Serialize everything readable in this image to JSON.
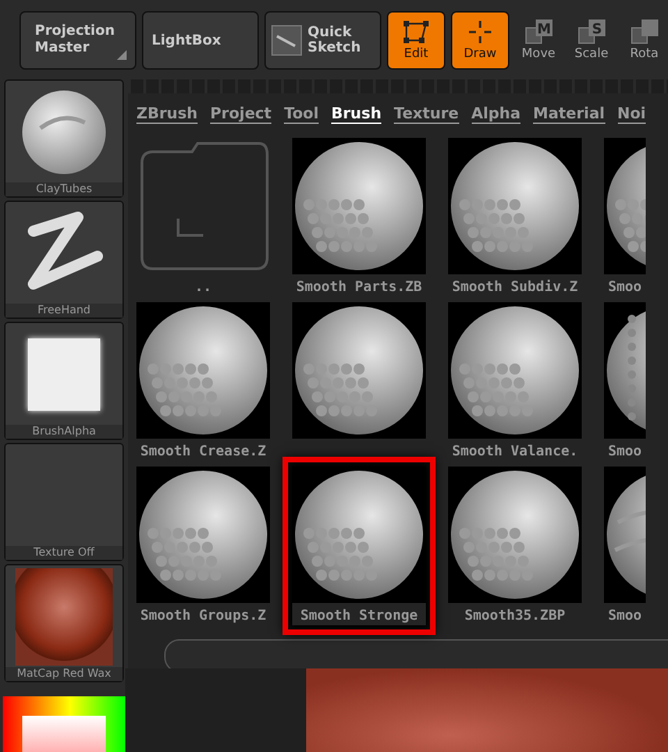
{
  "toolbar": [
    {
      "label": "Projection Master",
      "kind": "menu",
      "selected": false
    },
    {
      "label": "LightBox",
      "kind": "text",
      "selected": false
    },
    {
      "label": "Quick Sketch",
      "kind": "sketch",
      "selected": false
    },
    {
      "label": "Edit",
      "kind": "edit",
      "selected": true
    },
    {
      "label": "Draw",
      "kind": "draw",
      "selected": true
    },
    {
      "label": "Move",
      "kind": "move",
      "key": "M",
      "selected": false
    },
    {
      "label": "Scale",
      "kind": "scale",
      "key": "S",
      "selected": false
    },
    {
      "label": "Rota",
      "kind": "rotate",
      "selected": false
    }
  ],
  "palette": [
    {
      "label": "ClayTubes",
      "kind": "brush"
    },
    {
      "label": "FreeHand",
      "kind": "stroke"
    },
    {
      "label": "BrushAlpha",
      "kind": "alpha"
    },
    {
      "label": "Texture Off",
      "kind": "texture"
    },
    {
      "label": "MatCap Red Wax",
      "kind": "material"
    }
  ],
  "popup": {
    "tabs": [
      {
        "label": "ZBrush",
        "selected": false
      },
      {
        "label": "Project",
        "selected": false
      },
      {
        "label": "Tool",
        "selected": false
      },
      {
        "label": "Brush",
        "selected": true
      },
      {
        "label": "Texture",
        "selected": false
      },
      {
        "label": "Alpha",
        "selected": false
      },
      {
        "label": "Material",
        "selected": false
      },
      {
        "label": "Noi",
        "selected": false
      }
    ],
    "items": [
      {
        "label": "..",
        "kind": "folder",
        "selected": false
      },
      {
        "label": "Smooth Parts.ZB",
        "kind": "brush",
        "selected": false
      },
      {
        "label": "Smooth Subdiv.Z",
        "kind": "brush",
        "selected": false
      },
      {
        "label": "Smoo",
        "kind": "brush",
        "selected": false
      },
      {
        "label": "Smooth Crease.Z",
        "kind": "brush",
        "selected": false
      },
      {
        "kind": "brush",
        "selected": false
      },
      {
        "label": "Smooth Valance.",
        "kind": "brush",
        "selected": false
      },
      {
        "label": "Smoo",
        "kind": "noisy",
        "selected": false
      },
      {
        "label": "Smooth Groups.Z",
        "kind": "brush",
        "selected": false
      },
      {
        "label": "Smooth Stronge",
        "kind": "brush",
        "selected": true
      },
      {
        "label": "Smooth35.ZBP",
        "kind": "brush",
        "selected": false
      },
      {
        "label": "Smoo",
        "kind": "swirl",
        "selected": false
      }
    ]
  }
}
